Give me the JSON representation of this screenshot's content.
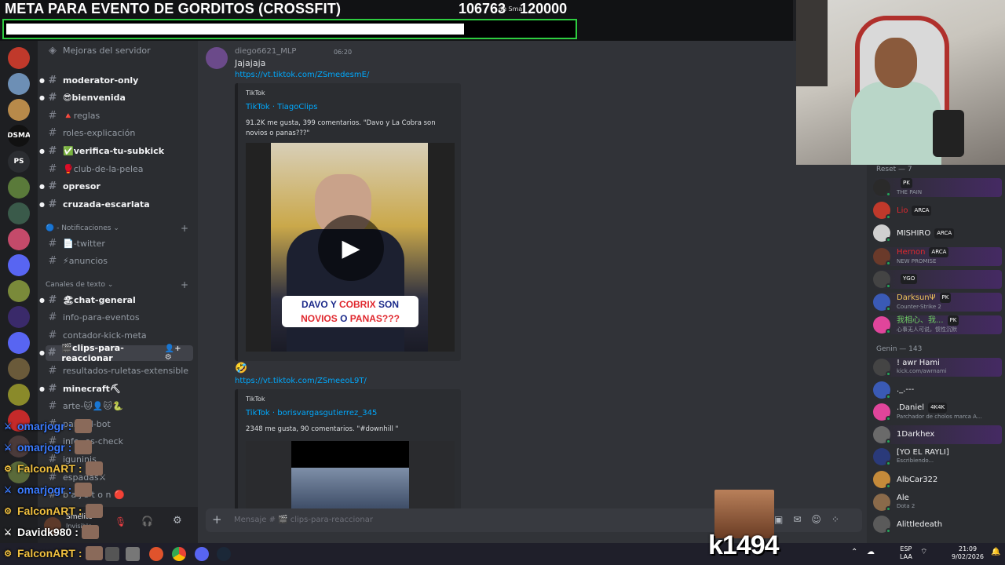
{
  "overlay": {
    "goal_title": "META PARA EVENTO DE GORDITOS (CROSSFIT)",
    "goal_current": "106763",
    "goal_target": "120000",
    "goal_sub": "de Sma",
    "goal_progress": 0.89,
    "kick_count": "k1494",
    "chat_lines": [
      {
        "user": "omarjogr",
        "color": "#3b7bff"
      },
      {
        "user": "omarjogr",
        "color": "#3b7bff"
      },
      {
        "user": "FalconART",
        "color": "#f0c040"
      },
      {
        "user": "omarjogr",
        "color": "#3b7bff"
      },
      {
        "user": "FalconART",
        "color": "#f0c040"
      },
      {
        "user": "Davidk980",
        "color": "#ffffff"
      },
      {
        "user": "FalconART",
        "color": "#f0c040"
      }
    ]
  },
  "servers": [
    "",
    "",
    "",
    "DSMA",
    "PS",
    "",
    "",
    "",
    "",
    "",
    "",
    "",
    "",
    "",
    "",
    "",
    ""
  ],
  "channels": {
    "boost": "Mejoras del servidor",
    "items": [
      {
        "name": "moderator-only",
        "bold": true
      },
      {
        "name": "😎bienvenida",
        "bold": true
      },
      {
        "name": "🔺reglas",
        "bold": false
      },
      {
        "name": "roles-explicación",
        "bold": false
      },
      {
        "name": "✅verifica-tu-subkick",
        "bold": true
      },
      {
        "name": "🥊club-de-la-pelea",
        "bold": false
      },
      {
        "name": "opresor",
        "bold": true
      },
      {
        "name": "cruzada-escarlata",
        "bold": true
      }
    ],
    "cat_notif": "Notificaciones",
    "notif_items": [
      {
        "name": "📄-twitter"
      },
      {
        "name": "⚡anuncios"
      }
    ],
    "cat_text": "Canales de texto",
    "text_items": [
      {
        "name": "🏖chat-general",
        "bold": true
      },
      {
        "name": "info-para-eventos",
        "bold": false
      },
      {
        "name": "contador-kick-meta",
        "bold": false
      },
      {
        "name": "🎬clips-para-reaccionar",
        "bold": true,
        "active": true
      },
      {
        "name": "resultados-ruletas-extensible",
        "bold": false
      },
      {
        "name": "minecraft⛏",
        "bold": true
      },
      {
        "name": "arte-🐱👤🐱🐍",
        "bold": false
      },
      {
        "name": "para-el-bot",
        "bold": false
      },
      {
        "name": "info-  es-check",
        "bold": false
      },
      {
        "name": "iguninis",
        "bold": false
      },
      {
        "name": "espadas⚔",
        "bold": false
      },
      {
        "name": "b a j s t o n 🔴",
        "bold": false
      }
    ]
  },
  "user_panel": {
    "name": "Smelito",
    "status": "Invisible"
  },
  "message": {
    "user": "diego6621_MLP",
    "time": "06:20",
    "text": "Jajajaja",
    "link1": "https://vt.tiktok.com/ZSmedesmE/",
    "embed1": {
      "site": "TikTok",
      "title": "TikTok · TiagoClips",
      "desc": "91.2K me gusta, 399 comentarios. \"Davo y La Cobra son novios o panas???\"",
      "caption_parts": [
        "DAVO",
        " Y ",
        "COBRIX",
        " SON",
        "NOVIOS",
        " O ",
        "PANAS???"
      ]
    },
    "emoji": "🤣",
    "link2": "https://vt.tiktok.com/ZSmeeoL9T/",
    "embed2": {
      "site": "TikTok",
      "title": "TikTok · borisvargasgutierrez_345",
      "desc": "2348 me gusta, 90 comentarios. \"#downhill \""
    }
  },
  "composer": {
    "placeholder": "Mensaje # 🎬 clips-para-reaccionar"
  },
  "members": {
    "group1": "Reset — 7",
    "group1_list": [
      {
        "name": "",
        "color": "#e0282e",
        "sub": "THE PAIN",
        "tag": "PK",
        "banner": true
      },
      {
        "name": "Lio",
        "color": "#e0282e",
        "sub": "",
        "tag": "ARCA",
        "banner": false
      },
      {
        "name": "MISHIRO",
        "color": "#f2f3f5",
        "sub": "",
        "tag": "ARCA",
        "banner": false
      },
      {
        "name": "Hernon",
        "color": "#e0282e",
        "sub": "NEW PROMISE",
        "tag": "ARCA",
        "banner": true
      },
      {
        "name": "",
        "color": "#e0282e",
        "sub": "",
        "tag": "YGO",
        "banner": true
      },
      {
        "name": "DarksunΨ",
        "color": "#f2c45a",
        "sub": "Counter-Strike 2",
        "tag": "PK",
        "banner": true
      },
      {
        "name": "我相心、我...",
        "color": "#6ecb63",
        "sub": "心事无人可说，惯性沉默",
        "tag": "PK",
        "banner": true
      }
    ],
    "group2": "Genin — 143",
    "group2_list": [
      {
        "name": "! awr Hami",
        "color": "#f2f3f5",
        "sub": "kick.com/awrnami",
        "tag": "",
        "banner": true
      },
      {
        "name": "._.---",
        "color": "#f2f3f5",
        "sub": "",
        "tag": "",
        "banner": false
      },
      {
        "name": ".Daniel",
        "color": "#f2f3f5",
        "sub": "Parchador de cholos marca A...",
        "tag": "4K4K",
        "banner": false
      },
      {
        "name": "1Darkhex",
        "color": "#f2f3f5",
        "sub": "",
        "tag": "",
        "banner": true
      },
      {
        "name": "[YO EL RAYLI]",
        "color": "#f2f3f5",
        "sub": "Escribiendo...",
        "tag": "",
        "banner": false
      },
      {
        "name": "AlbCar322",
        "color": "#f2f3f5",
        "sub": "",
        "tag": "",
        "banner": false
      },
      {
        "name": "Ale",
        "color": "#f2f3f5",
        "sub": "Dota 2",
        "tag": "",
        "banner": false
      },
      {
        "name": "Alittledeath",
        "color": "#f2f3f5",
        "sub": "",
        "tag": "",
        "banner": false
      }
    ]
  },
  "taskbar": {
    "lang": "ESP",
    "lang2": "LAA",
    "time": "21:09",
    "date": "9/02/2026"
  }
}
